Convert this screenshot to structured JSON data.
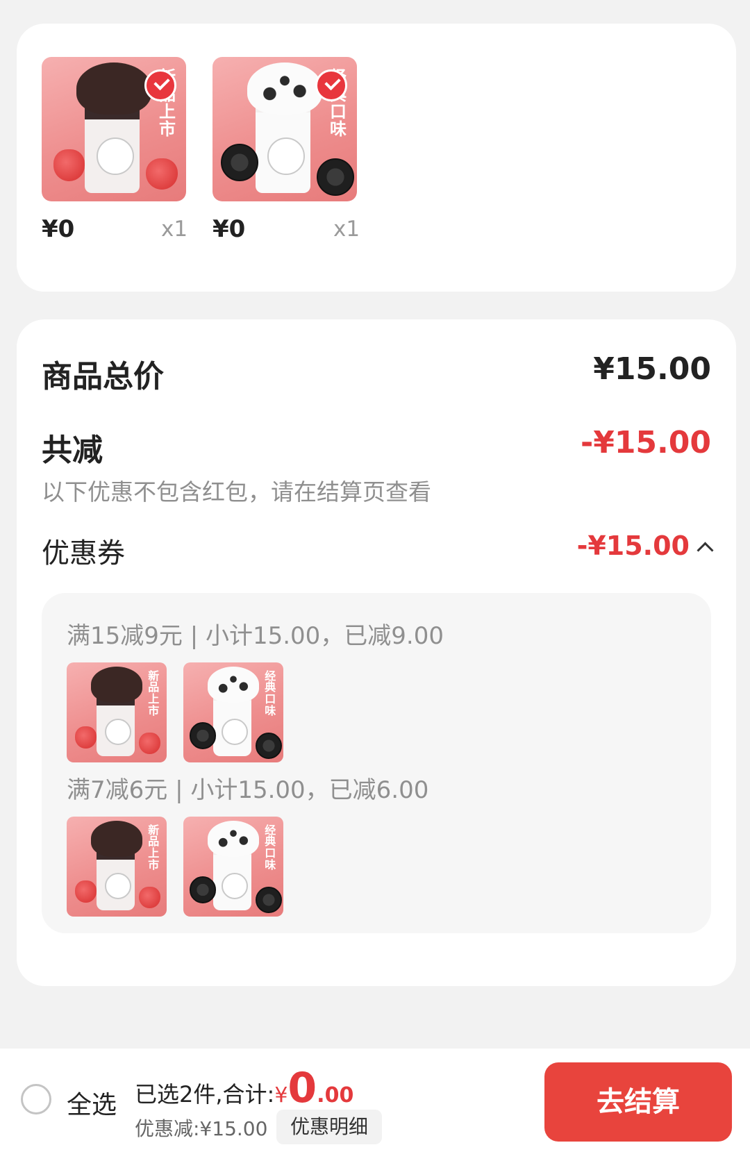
{
  "items": [
    {
      "name_tag": "新品上市",
      "price": "¥0",
      "qty": "x1",
      "flavor": "chocolate-strawberry"
    },
    {
      "name_tag": "经典口味",
      "price": "¥0",
      "qty": "x1",
      "flavor": "oreo"
    }
  ],
  "summary": {
    "total_label": "商品总价",
    "total_value": "¥15.00",
    "reduce_label": "共减",
    "reduce_value": "-¥15.00",
    "note": "以下优惠不包含红包，请在结算页查看",
    "coupon_label": "优惠券",
    "coupon_value": "-¥15.00",
    "coupon_toggle_icon": "chevron-up-icon"
  },
  "coupon_rules": [
    {
      "text": "满15减9元 | 小计15.00，已减9.00"
    },
    {
      "text": "满7减6元 | 小计15.00，已减6.00"
    }
  ],
  "bottom": {
    "select_all": "全选",
    "selected_prefix": "已选2件,合计:",
    "currency": "¥",
    "total_int": "0",
    "total_dec": ".00",
    "discount": "优惠减:¥15.00",
    "detail_button": "优惠明细",
    "checkout_button": "去结算"
  },
  "colors": {
    "accent": "#e8443d",
    "discount_red": "#e4393c",
    "card": "#ffffff",
    "background": "#f2f2f2"
  }
}
